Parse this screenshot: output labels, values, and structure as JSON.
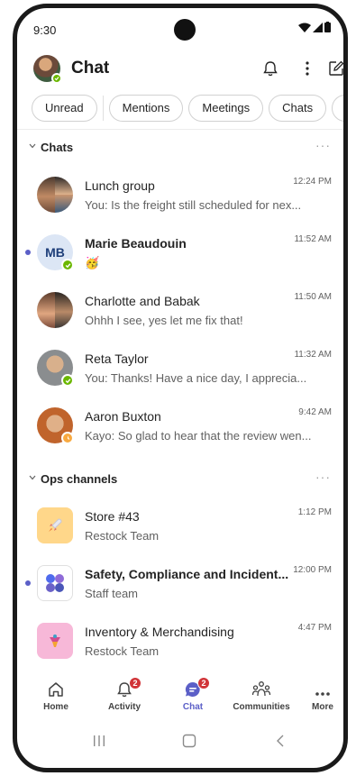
{
  "status_bar": {
    "time": "9:30"
  },
  "header": {
    "title": "Chat"
  },
  "filters": [
    "Unread",
    "Mentions",
    "Meetings",
    "Chats",
    "I"
  ],
  "sections": {
    "chats": {
      "label": "Chats",
      "more": "···"
    },
    "ops": {
      "label": "Ops channels",
      "more": "···"
    }
  },
  "chats": [
    {
      "name": "Lunch group",
      "preview": "You: Is the freight still scheduled for nex...",
      "time": "12:24 PM"
    },
    {
      "name": "Marie Beaudouin",
      "initials": "MB",
      "preview": "🥳",
      "time": "11:52 AM"
    },
    {
      "name": "Charlotte and Babak",
      "preview": "Ohhh I see, yes let me fix that!",
      "time": "11:50 AM"
    },
    {
      "name": "Reta Taylor",
      "preview": "You: Thanks! Have a nice day, I apprecia...",
      "time": "11:32 AM"
    },
    {
      "name": "Aaron Buxton",
      "preview": "Kayo: So glad to hear that the review wen...",
      "time": "9:42 AM"
    }
  ],
  "channels": [
    {
      "name": "Store #43",
      "preview": "Restock Team",
      "time": "1:12 PM"
    },
    {
      "name": "Safety, Compliance and Incident...",
      "preview": "Staff team",
      "time": "12:00 PM"
    },
    {
      "name": "Inventory & Merchandising",
      "preview": "Restock Team",
      "time": "4:47 PM"
    }
  ],
  "tabs": [
    {
      "label": "Home",
      "icon": "home-icon"
    },
    {
      "label": "Activity",
      "icon": "bell-icon",
      "badge": "2"
    },
    {
      "label": "Chat",
      "icon": "chat-icon",
      "badge": "2"
    },
    {
      "label": "Communities",
      "icon": "communities-icon"
    },
    {
      "label": "More",
      "icon": "more-icon"
    }
  ],
  "colors": {
    "accent": "#5b5fc7",
    "badge": "#d13438",
    "presence_available": "#6bb700",
    "presence_away": "#f8a940"
  }
}
